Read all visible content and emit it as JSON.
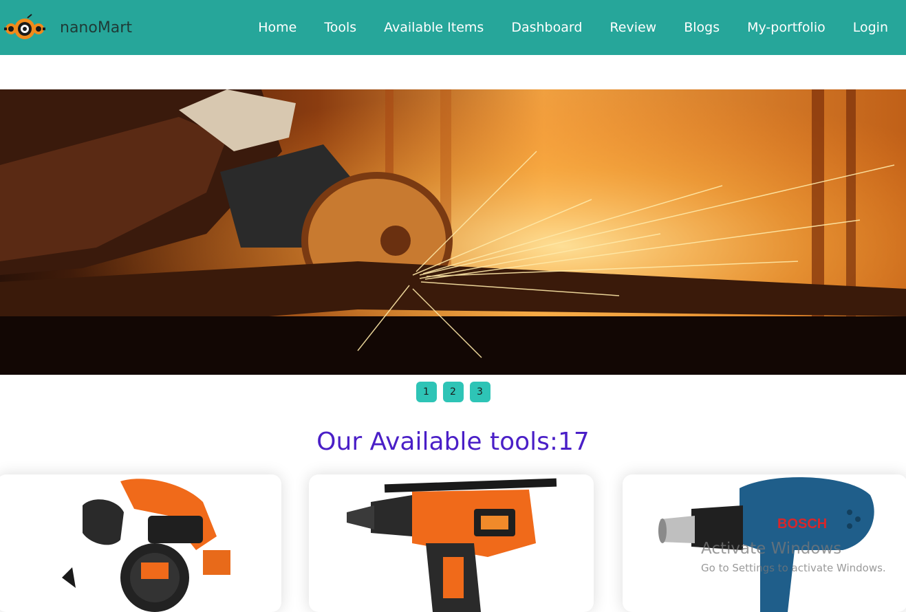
{
  "brand": {
    "name": "nanoMart",
    "logo_icon": "gear-eye-logo-icon"
  },
  "nav": {
    "home": "Home",
    "tools": "Tools",
    "available_items": "Available Items",
    "dashboard": "Dashboard",
    "review": "Review",
    "blogs": "Blogs",
    "portfolio": "My-portfolio",
    "login": "Login"
  },
  "hero": {
    "image": "angle-grinder-sparks-photo"
  },
  "pagination": [
    "1",
    "2",
    "3"
  ],
  "section": {
    "title": "Our Available tools:",
    "count": "17"
  },
  "cards": [
    {
      "image": "black-decker-circular-saw-photo"
    },
    {
      "image": "black-decker-hammer-drill-photo"
    },
    {
      "image": "bosch-heat-gun-photo"
    }
  ],
  "watermark": {
    "title": "Activate Windows",
    "subtitle": "Go to Settings to activate Windows."
  },
  "colors": {
    "navbar": "#26a69a",
    "pager": "#2ec4b6",
    "title": "#4a1fc7"
  }
}
